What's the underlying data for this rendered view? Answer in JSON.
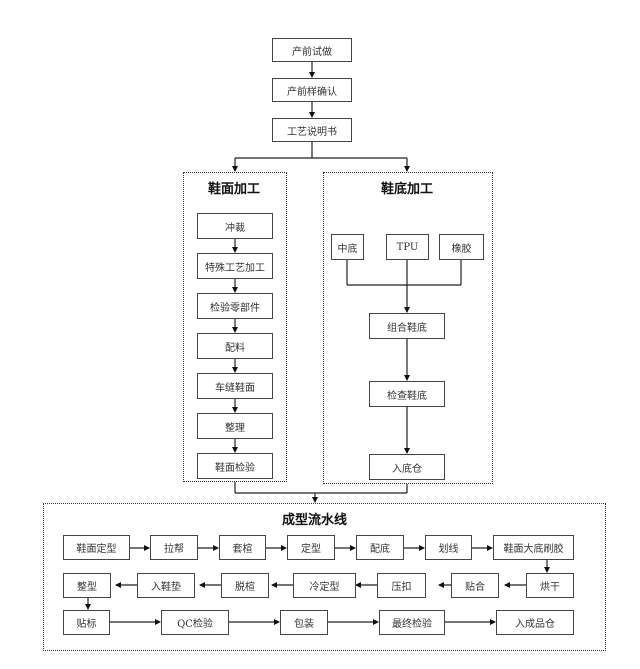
{
  "top_steps": [
    "产前试做",
    "产前样确认",
    "工艺说明书"
  ],
  "upper_section": {
    "title": "鞋面加工",
    "steps": [
      "冲裁",
      "特殊工艺加工",
      "检验零部件",
      "配料",
      "车缝鞋面",
      "整理",
      "鞋面检验"
    ]
  },
  "sole_section": {
    "title": "鞋底加工",
    "materials": [
      "中底",
      "TPU",
      "橡胶"
    ],
    "steps": [
      "组合鞋底",
      "检查鞋底",
      "入底仓"
    ]
  },
  "assembly_line": {
    "title": "成型流水线",
    "row1": [
      "鞋面定型",
      "拉帮",
      "套楦",
      "定型",
      "配底",
      "划线",
      "鞋面大底刷胶"
    ],
    "row2_right_to_left": [
      "烘干",
      "贴合",
      "压扣",
      "冷定型",
      "脱楦",
      "入鞋垫",
      "整型"
    ],
    "row3": [
      "贴标",
      "QC检验",
      "包装",
      "最终检验",
      "入成品仓"
    ]
  },
  "colors": {
    "line": "#222222",
    "border": "#444444"
  }
}
